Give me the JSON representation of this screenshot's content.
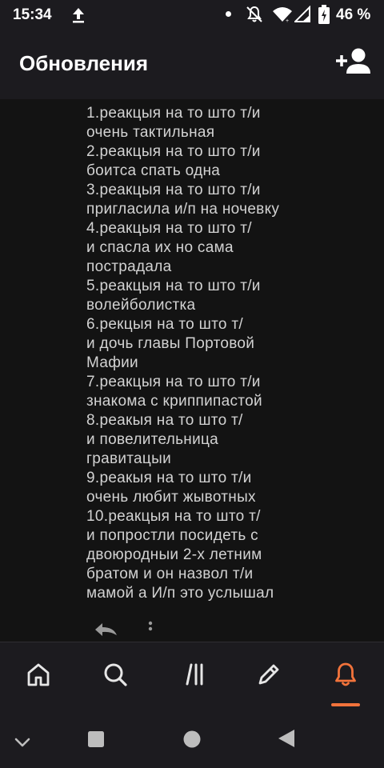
{
  "status_bar": {
    "time": "15:34",
    "battery": "46 %",
    "icons": [
      "upload-icon",
      "notification-dot-icon",
      "mute-icon",
      "wifi-icon",
      "signal-icon",
      "battery-icon"
    ]
  },
  "header": {
    "title": "Обновления",
    "add_user_icon": "add-user-icon"
  },
  "update": {
    "lines": [
      "1.реакцыя на то што т/и",
      "очень тактильная",
      "2.реакцыя на то што т/и",
      "боитса спать одна",
      "3.реакцыя на то што т/и",
      "пригласила и/п на ночевку",
      "4.реакцыя на то што т/",
      "и спасла их но сама",
      "пострадала",
      "5.реакцыя на то што т/и",
      "волейболистка",
      "6.рекцыя на то што т/",
      "и дочь главы Портовой",
      "Мафии",
      "7.реакцыя на то што т/и",
      "знакома с криппипастой",
      "8.реакыя на то што т/",
      "и повелительница",
      "гравитацыи",
      "9.реакыя на то што т/и",
      "очень любит жывотных",
      "10.реакцыя на то што т/",
      "и попростли посидеть с",
      "двоюродныи 2-х летним",
      "братом и он назвол т/и",
      "мамой а И/п это услышал"
    ]
  },
  "bottom_nav": {
    "items": [
      "home-icon",
      "search-icon",
      "library-icon",
      "write-icon",
      "notifications-icon"
    ],
    "active": "notifications-icon",
    "accent_color": "#f2733b"
  },
  "system_nav": {
    "buttons": [
      "collapse-icon",
      "recents-icon",
      "home-circle-icon",
      "back-icon"
    ]
  }
}
